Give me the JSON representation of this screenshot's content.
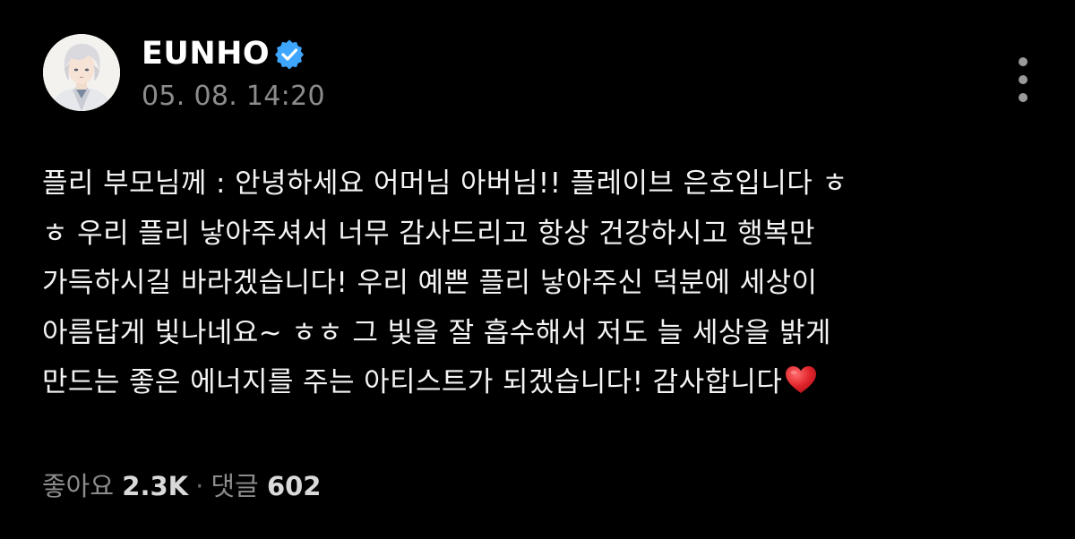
{
  "author": {
    "name": "EUNHO",
    "verified": true,
    "avatar_icon": "avatar-character-icon",
    "verified_icon": "verified-badge-icon"
  },
  "post": {
    "timestamp": "05. 08. 14:20",
    "body_lines": [
      "플리 부모님께 : 안녕하세요 어머님 아버님!! 플레이브 은호입니다 ㅎ",
      "ㅎ 우리 플리 낳아주셔서 너무 감사드리고 항상 건강하시고 행복만",
      "가득하시길 바라겠습니다! 우리 예쁜 플리 낳아주신 덕분에 세상이",
      "아름답게 빛나네요~ ㅎㅎ 그 빛을 잘 흡수해서 저도 늘 세상을 밝게",
      "만드는 좋은 에너지를 주는 아티스트가 되겠습니다! 감사합니다"
    ],
    "end_emoji": "heart-icon"
  },
  "stats": {
    "likes_label": "좋아요",
    "likes_count": "2.3K",
    "separator": "·",
    "comments_label": "댓글",
    "comments_count": "602"
  },
  "menu": {
    "icon": "more-vertical-icon"
  },
  "colors": {
    "background": "#000000",
    "text": "#f4f4f4",
    "muted": "#8c8c8c",
    "verified": "#3ea6ff",
    "heart": "#e0242b"
  }
}
